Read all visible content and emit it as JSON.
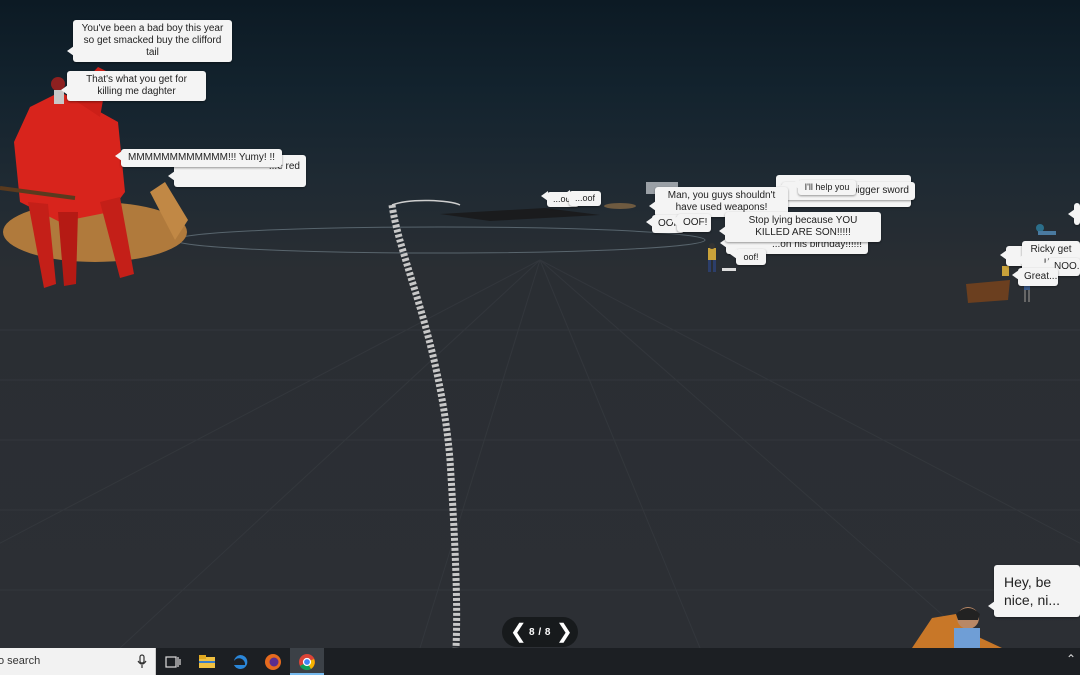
{
  "bubbles": {
    "bad_boy": "You've been a bad boy this year so get smacked buy the clifford tail",
    "killing": "That's what you get for killing me daghter",
    "yumy": "MMMMMMMMMMMM!!! Yumy! !!",
    "red": "...e red",
    "oof_dots1": "...oof",
    "oof_dots2": "...oof",
    "weapons": "Man, you guys shouldn't have used weapons!",
    "help": "I'll help you",
    "sword": "...bigger sword",
    "oof_caps1": "OOF",
    "oof_caps2": "OOF!",
    "lying": "Stop lying because YOU KILLED ARE SON!!!!!",
    "birthday": "...on his birthday!!!!!!",
    "oof_small": "oof!",
    "ricky": "Ricky get u...",
    "noo": "NOO...",
    "great": "Great...",
    "nice": "Hey, be nice, ni..."
  },
  "pager": {
    "prev_icon": "chevron-left-icon",
    "count": "8 / 8",
    "next_icon": "chevron-right-icon"
  },
  "taskbar": {
    "search_placeholder": "o search",
    "icons": [
      "microphone-icon",
      "task-view-icon",
      "file-explorer-icon",
      "edge-icon",
      "firefox-icon",
      "chrome-icon"
    ],
    "tray": "chevron-up-icon"
  }
}
